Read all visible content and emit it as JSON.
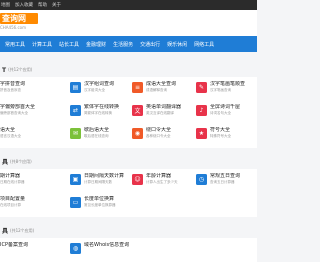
{
  "topbar": {
    "items": [
      "地图",
      "加入收藏",
      "帮助",
      "关于"
    ]
  },
  "logo": {
    "main": "查询网",
    "sub": "CHA456.com"
  },
  "nav": {
    "items": [
      "常用工具",
      "计算工具",
      "站长工具",
      "金融理财",
      "生活服务",
      "交通出行",
      "娱乐休闲",
      "网络工具"
    ]
  },
  "sections": [
    {
      "title": "T",
      "count": "(共12个应用)",
      "tools": [
        {
          "name": "字拼音查询",
          "desc": "拼音及音序查",
          "icon": "search-icon",
          "color": "#ffffff"
        },
        {
          "name": "汉字组词查询",
          "desc": "汉字组词大全",
          "icon": "book-icon",
          "color": "#1f7dd6"
        },
        {
          "name": "成语大全查询",
          "desc": "成语解释查询",
          "icon": "scroll-icon",
          "color": "#f05a28"
        },
        {
          "name": "汉字笔画笔顺查",
          "desc": "汉字笔画查询",
          "icon": "pen-icon",
          "color": "#e8334a"
        },
        {
          "name": "字偏旁部首大全",
          "desc": "偏旁部首查询大全",
          "icon": "grid-icon",
          "color": "#ffffff"
        },
        {
          "name": "繁体字在线转换",
          "desc": "简繁体字在线转换",
          "icon": "swap-icon",
          "color": "#1f7dd6"
        },
        {
          "name": "英语单词翻译器",
          "desc": "英汉互译在线翻译",
          "icon": "translate-icon",
          "color": "#e8334a"
        },
        {
          "name": "全屏诗词千屋",
          "desc": "诗词名句大全",
          "icon": "poem-icon",
          "color": "#e8334a"
        },
        {
          "name": "语大全",
          "desc": "语言汉语大全",
          "icon": "quote-icon",
          "color": "#ffffff"
        },
        {
          "name": "歇后语大全",
          "desc": "歇后语在线查询",
          "icon": "chat-icon",
          "color": "#7cc13a"
        },
        {
          "name": "绕口令大全",
          "desc": "各种绕口令大全",
          "icon": "mouth-icon",
          "color": "#f05a28"
        },
        {
          "name": "符号大全",
          "desc": "特殊符号大全",
          "icon": "star-icon",
          "color": "#e8334a"
        }
      ]
    },
    {
      "title": "具",
      "count": "(共8个应用)",
      "tools": [
        {
          "name": "期计算器",
          "desc": "日期在线计算器",
          "icon": "calendar-icon",
          "color": "#ffffff"
        },
        {
          "name": "日期间隔天数计算",
          "desc": "计算日期间隔天数",
          "icon": "calendar-icon",
          "color": "#1f7dd6"
        },
        {
          "name": "年龄计算器",
          "desc": "计算人出生了多少天",
          "icon": "person-icon",
          "color": "#e8334a"
        },
        {
          "name": "常规五日查询",
          "desc": "查询五日计算器",
          "icon": "clock-icon",
          "color": "#1f7dd6"
        },
        {
          "name": "项目配置量",
          "desc": "在线项目计算",
          "icon": "list-icon",
          "color": "#ffffff"
        },
        {
          "name": "长度单位换算",
          "desc": "常见长度单位换算器",
          "icon": "ruler-icon",
          "color": "#1f7dd6"
        }
      ]
    },
    {
      "title": "具",
      "count": "(共12个应用)",
      "tools": [
        {
          "name": "ICP备案查询",
          "desc": "",
          "icon": "shield-icon",
          "color": "#ffffff"
        },
        {
          "name": "域名Whois信息查询",
          "desc": "",
          "icon": "globe-icon",
          "color": "#1f7dd6"
        }
      ]
    }
  ]
}
